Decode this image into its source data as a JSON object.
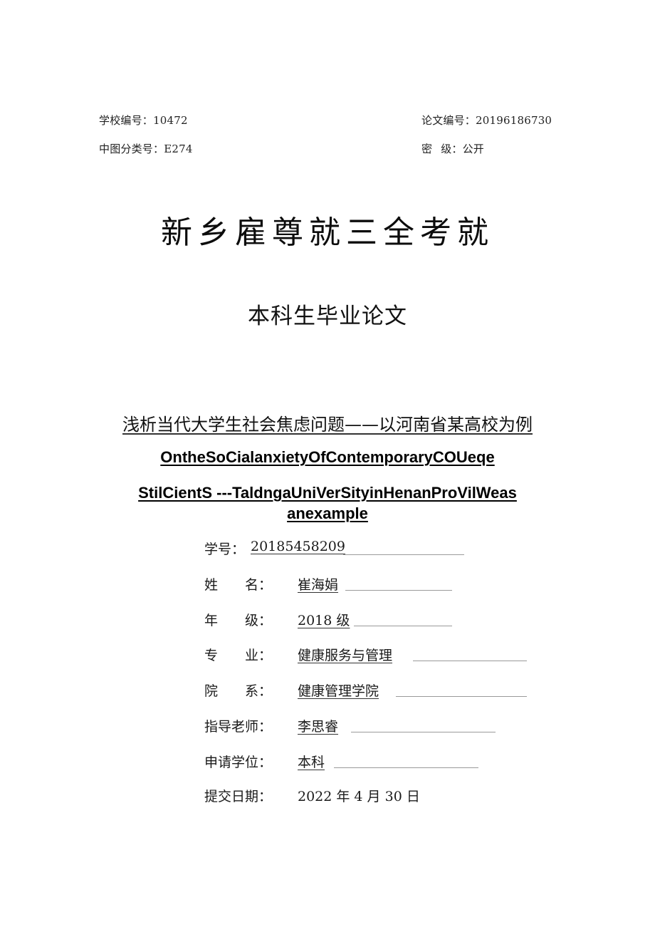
{
  "header": {
    "school_code": "学校编号：10472",
    "thesis_number": "论文编号：20196186730",
    "clc_number": "中图分类号：E274",
    "secrecy_label_1": "密",
    "secrecy_label_2": "级：公开"
  },
  "university_name": "新乡雇尊就三全考就",
  "document_type": "本科生毕业论文",
  "title": {
    "chinese": "浅析当代大学生社会焦虑问题——以河南省某高校为例",
    "english_line1": "OntheSoCialanxietyOfContemporaryCOUeqe",
    "english_line2": "StilCientS ---TaldngaUniVerSityinHenanProVilWeas",
    "english_line3": "anexample"
  },
  "fields": {
    "student_id": {
      "label": "学号：",
      "value": "20185458209"
    },
    "name": {
      "label_1": "姓",
      "label_2": "名：",
      "value": "崔海娟"
    },
    "grade": {
      "label_1": "年",
      "label_2": "级：",
      "value": "2018 级"
    },
    "major": {
      "label_1": "专",
      "label_2": "业：",
      "value": "健康服务与管理"
    },
    "department": {
      "label_1": "院",
      "label_2": "系：",
      "value": "健康管理学院"
    },
    "advisor": {
      "label": "指导老师：",
      "value": "李思睿"
    },
    "degree": {
      "label": "申请学位：",
      "value": "本科"
    },
    "submission_date": {
      "label": "提交日期：",
      "value": "2022 年 4 月 30 日"
    }
  }
}
